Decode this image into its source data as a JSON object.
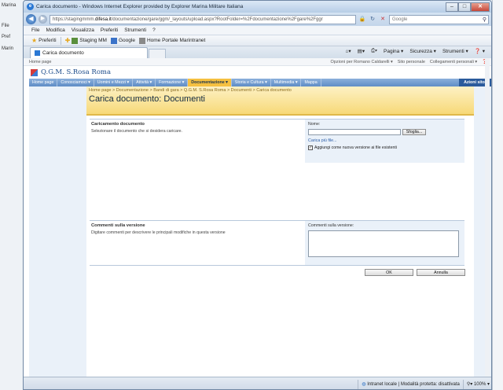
{
  "background": {
    "left_texts": [
      "Marina",
      "File",
      "Pref",
      "Marin"
    ]
  },
  "window": {
    "title": "Carica documento - Windows Internet Explorer provided by Explorer Marina Militare Italiana",
    "min": "–",
    "max": "□",
    "close": "✕"
  },
  "address": {
    "url_pre": "https://stagingmmm.",
    "url_host": "difesa.it",
    "url_post": "/documentazione/gare/ggm/_layouts/upload.aspx?RootFolder=%2Fdocumentazione%2Fgare%2Fggr",
    "search_placeholder": "Google"
  },
  "menu": [
    "File",
    "Modifica",
    "Visualizza",
    "Preferiti",
    "Strumenti",
    "?"
  ],
  "favorites": {
    "label": "Preferiti",
    "items": [
      "Staging MM",
      "Google",
      "Home Portale Marintranet"
    ]
  },
  "tab": {
    "label": "Carica documento"
  },
  "commands": [
    "Pagina ▾",
    "Sicurezza ▾",
    "Strumenti ▾",
    "❓ ▾"
  ],
  "sp": {
    "home": "Home page",
    "user": "Opzioni per Romano Caldarelli ▾",
    "personal_site": "Sito personale",
    "links": "Collegamenti personali ▾",
    "site_name": "Q.G.M. S.Rosa Roma",
    "nav": [
      "Home page",
      "Conosciamoci ▾",
      "Uomini e Mezzi ▾",
      "Attività ▾",
      "Formazione ▾",
      "Documentazione ▾",
      "Storia e Cultura ▾",
      "Multimedia ▾",
      "Mappa"
    ],
    "nav_selected": 5,
    "actions": "Azioni sito ▾",
    "breadcrumb": "Home page > Documentazione > Bandi di gara > Q.G.M. S.Rosa Roma > Documenti > Carica documento",
    "page_title": "Carica documento: Documenti"
  },
  "upload": {
    "title": "Caricamento documento",
    "desc": "Selezionare il documento che si desidera caricare.",
    "name_label": "Nome:",
    "browse": "Sfoglia...",
    "multi_link": "Carica più file...",
    "add_version_label": "Aggiungi come nuova versione ai file esistenti",
    "add_version_checked": "✓"
  },
  "comments": {
    "title": "Commenti sulla versione",
    "desc": "Digitare commenti per descrivere le principali modifiche in questa versione",
    "label": "Commenti sulla versione:"
  },
  "buttons": {
    "ok": "OK",
    "cancel": "Annulla"
  },
  "status": {
    "zone": "Intranet locale | Modalità protetta: disattivata",
    "zoom": "100%"
  }
}
